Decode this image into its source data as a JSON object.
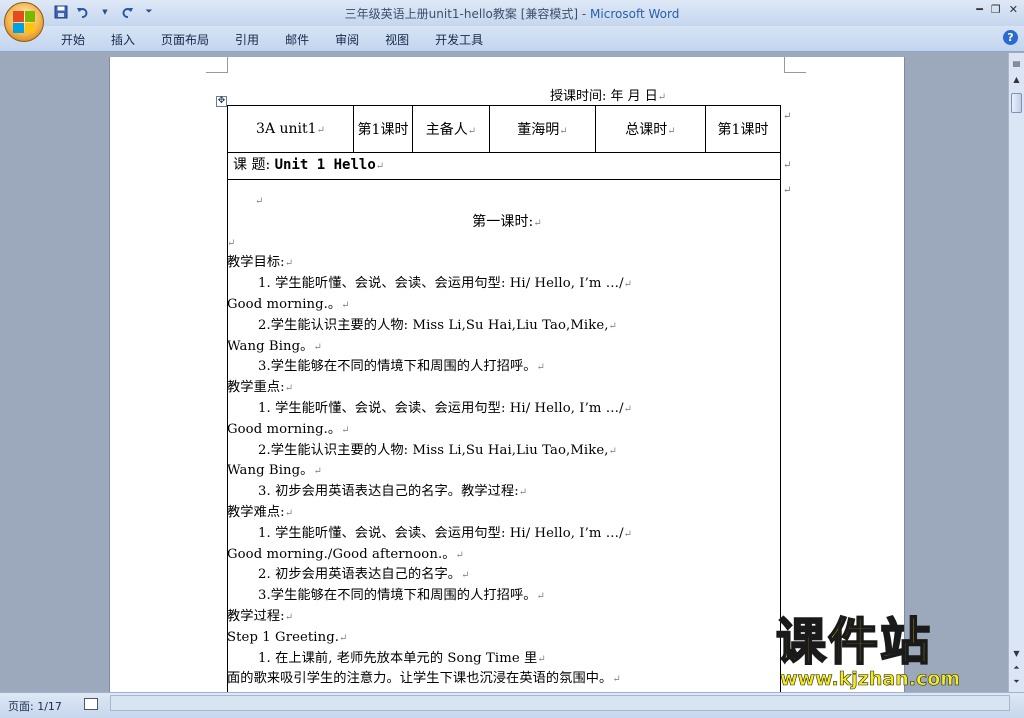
{
  "window": {
    "title": "三年级英语上册unit1-hello教案 [兼容模式]",
    "separator": " - ",
    "app_name": "Microsoft Word"
  },
  "ribbon": {
    "tabs": [
      "开始",
      "插入",
      "页面布局",
      "引用",
      "邮件",
      "审阅",
      "视图",
      "开发工具"
    ]
  },
  "document": {
    "date_line": "授课时间:  年   月   日",
    "header_table": [
      "3A  unit1",
      "第1课时",
      "主备人",
      "董海明",
      "总课时",
      "第1课时"
    ],
    "topic_label": "课 题:",
    "topic_value": "Unit 1   Hello",
    "lesson_title": "第一课时:",
    "lines": [
      {
        "text": "",
        "style": "blank"
      },
      {
        "text": "第一课时:",
        "style": "center"
      },
      {
        "text": "",
        "style": "blank"
      },
      {
        "text": "教学目标:",
        "style": "plain"
      },
      {
        "text": "1. 学生能听懂、会说、会读、会运用句型: Hi/ Hello, I’m …/",
        "style": "indent"
      },
      {
        "text": "Good morning.。",
        "style": "plain"
      },
      {
        "text": "2.学生能认识主要的人物: Miss Li,Su Hai,Liu Tao,Mike,",
        "style": "indent"
      },
      {
        "text": "Wang Bing。",
        "style": "plain"
      },
      {
        "text": "3.学生能够在不同的情境下和周围的人打招呼。",
        "style": "indent"
      },
      {
        "text": "教学重点:",
        "style": "plain"
      },
      {
        "text": "1. 学生能听懂、会说、会读、会运用句型: Hi/ Hello, I’m …/",
        "style": "indent"
      },
      {
        "text": "Good morning.。",
        "style": "plain"
      },
      {
        "text": "2.学生能认识主要的人物: Miss Li,Su Hai,Liu Tao,Mike,",
        "style": "indent"
      },
      {
        "text": "Wang Bing。",
        "style": "plain"
      },
      {
        "text": "3. 初步会用英语表达自己的名字。教学过程:",
        "style": "indent"
      },
      {
        "text": "教学难点:",
        "style": "plain"
      },
      {
        "text": "1. 学生能听懂、会说、会读、会运用句型: Hi/ Hello, I’m …/",
        "style": "indent"
      },
      {
        "text": "Good morning./Good afternoon.。",
        "style": "plain"
      },
      {
        "text": "2. 初步会用英语表达自己的名字。",
        "style": "indent"
      },
      {
        "text": "3.学生能够在不同的情境下和周围的人打招呼。",
        "style": "indent"
      },
      {
        "text": "教学过程:",
        "style": "plain"
      },
      {
        "text": "Step 1 Greeting.",
        "style": "plain"
      },
      {
        "text": "1. 在上课前, 老师先放本单元的 Song Time 里",
        "style": "indent"
      },
      {
        "text": "面的歌来吸引学生的注意力。让学生下课也沉浸在英语的氛围中。",
        "style": "plain"
      }
    ]
  },
  "statusbar": {
    "page_count": "页面: 1/17"
  },
  "watermark": {
    "brand": "课件站",
    "url": "www.kjzhan.com"
  },
  "icons": {
    "office_button": "office-logo-icon",
    "save": "save-icon",
    "undo": "undo-icon",
    "redo": "redo-icon",
    "help": "help-icon"
  }
}
